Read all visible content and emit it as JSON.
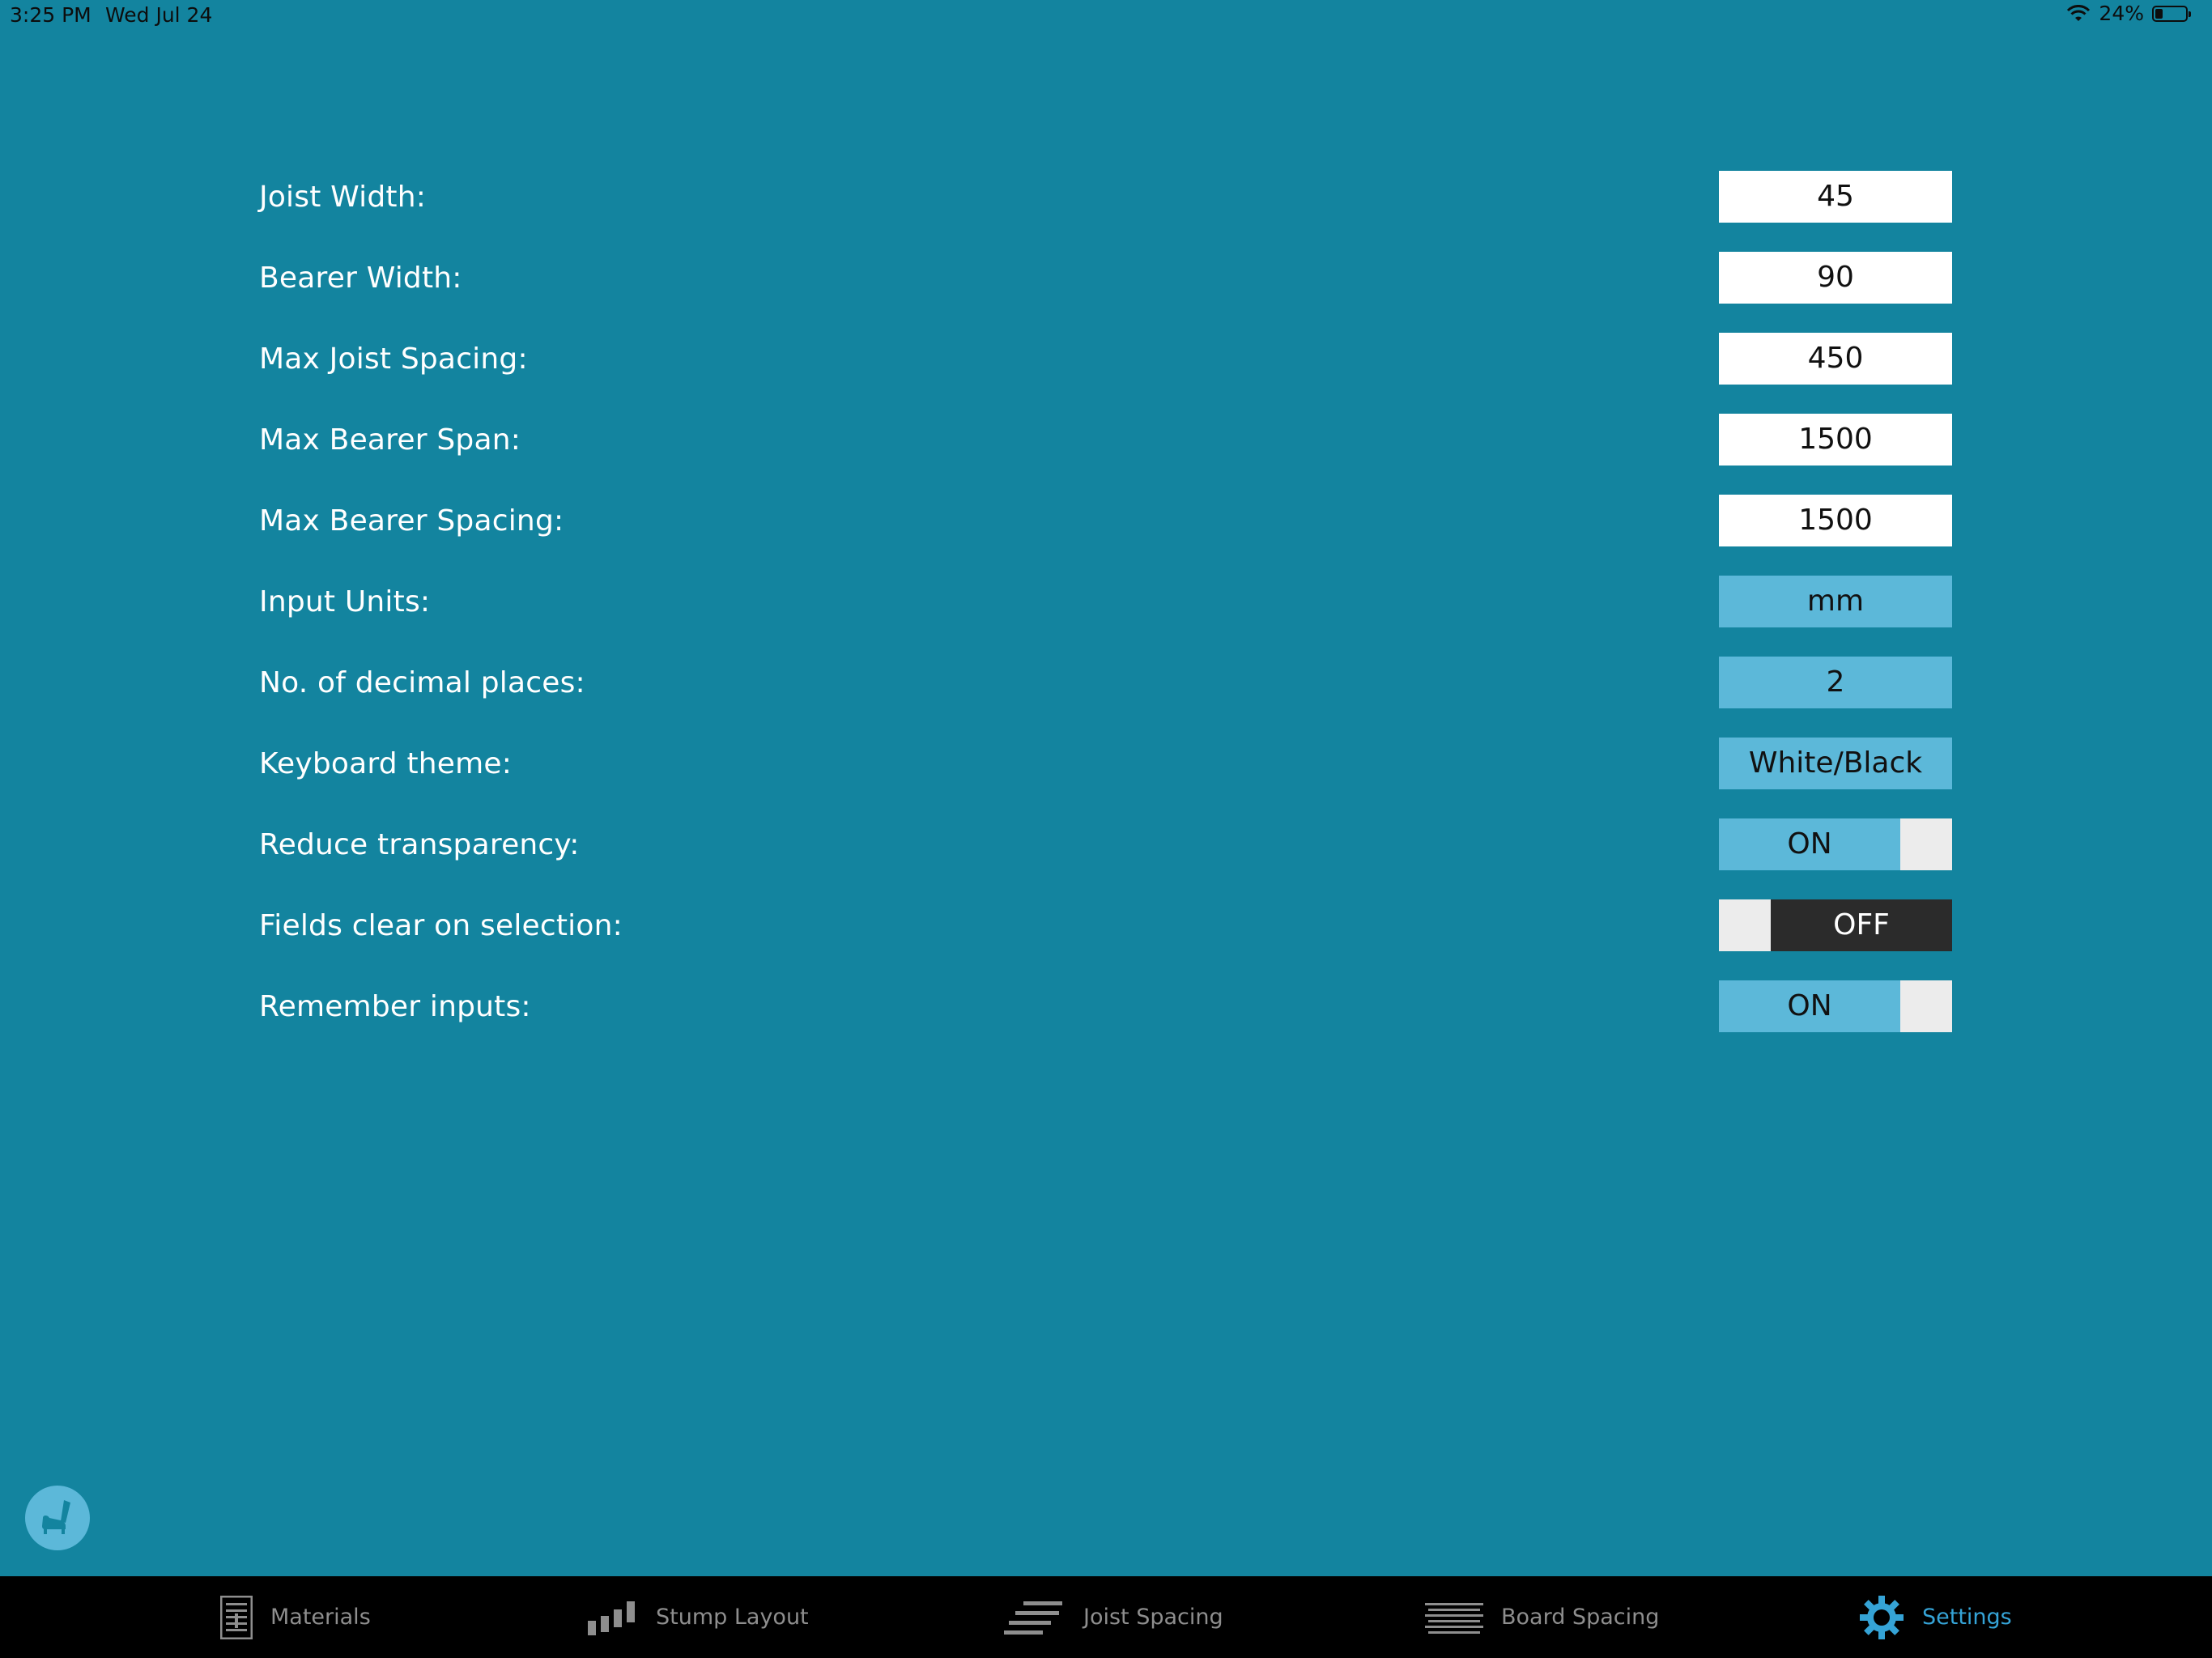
{
  "status_bar": {
    "time": "3:25 PM",
    "date": "Wed Jul 24",
    "battery": "24%",
    "battery_level": 0.24
  },
  "settings": [
    {
      "label": "Joist Width:",
      "value": "45",
      "control": "text-field"
    },
    {
      "label": "Bearer Width:",
      "value": "90",
      "control": "text-field"
    },
    {
      "label": "Max Joist Spacing:",
      "value": "450",
      "control": "text-field"
    },
    {
      "label": "Max Bearer Span:",
      "value": "1500",
      "control": "text-field"
    },
    {
      "label": "Max Bearer Spacing:",
      "value": "1500",
      "control": "text-field"
    },
    {
      "label": "Input Units:",
      "value": "mm",
      "control": "select"
    },
    {
      "label": "No. of decimal places:",
      "value": "2",
      "control": "select"
    },
    {
      "label": "Keyboard theme:",
      "value": "White/Black",
      "control": "select"
    },
    {
      "label": "Reduce transparency:",
      "value": "ON",
      "control": "toggle",
      "state": true
    },
    {
      "label": "Fields clear on selection:",
      "value": "OFF",
      "control": "toggle",
      "state": false
    },
    {
      "label": "Remember inputs:",
      "value": "ON",
      "control": "toggle",
      "state": true
    }
  ],
  "help_button": {
    "icon": "chair-icon"
  },
  "tabs": [
    {
      "label": "Materials",
      "icon": "document-icon",
      "active": false
    },
    {
      "label": "Stump Layout",
      "icon": "stumps-icon",
      "active": false
    },
    {
      "label": "Joist Spacing",
      "icon": "joists-icon",
      "active": false
    },
    {
      "label": "Board Spacing",
      "icon": "boards-icon",
      "active": false
    },
    {
      "label": "Settings",
      "icon": "gear-icon",
      "active": true
    }
  ],
  "colors": {
    "background": "#13849f",
    "control_accent": "#5cb8d9",
    "toggle_off": "#2b2b2b",
    "tab_active": "#35a3d6",
    "tab_inactive": "#8e8e8e"
  }
}
